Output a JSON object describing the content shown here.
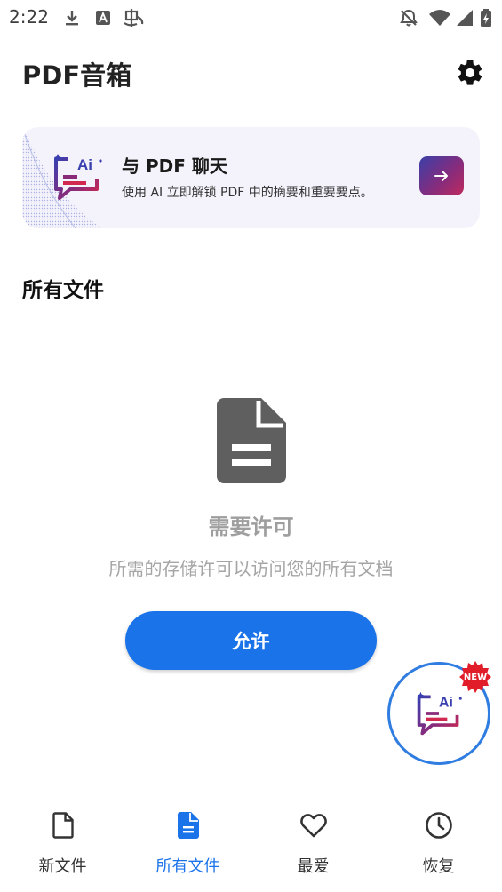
{
  "status_bar": {
    "time": "2:22",
    "left_icons": [
      "download-icon",
      "font-icon",
      "chinese-input-icon"
    ],
    "right_icons": [
      "notifications-off-icon",
      "wifi-icon",
      "signal-icon",
      "battery-charging-icon"
    ]
  },
  "header": {
    "title": "PDF音箱",
    "settings_icon": "gear-icon"
  },
  "promo": {
    "title": "与 PDF 聊天",
    "description": "使用 AI 立即解锁 PDF 中的摘要和重要要点。",
    "ai_icon_text": "Ai",
    "arrow_icon": "arrow-right-icon"
  },
  "section": {
    "title": "所有文件"
  },
  "empty_state": {
    "icon": "document-icon",
    "title": "需要许可",
    "description": "所需的存储许可以访问您的所有文档",
    "button_label": "允许"
  },
  "fab": {
    "ai_icon_text": "Ai",
    "badge": "NEW"
  },
  "bottom_nav": {
    "items": [
      {
        "label": "新文件",
        "icon": "file-outline-icon",
        "active": false
      },
      {
        "label": "所有文件",
        "icon": "file-filled-icon",
        "active": true
      },
      {
        "label": "最爱",
        "icon": "heart-icon",
        "active": false
      },
      {
        "label": "恢复",
        "icon": "clock-icon",
        "active": false
      }
    ]
  },
  "colors": {
    "accent": "#1a73e8",
    "promo_bg": "#f4f3fb",
    "empty_text": "#9e9e9e",
    "badge_red": "#e11d2a"
  }
}
